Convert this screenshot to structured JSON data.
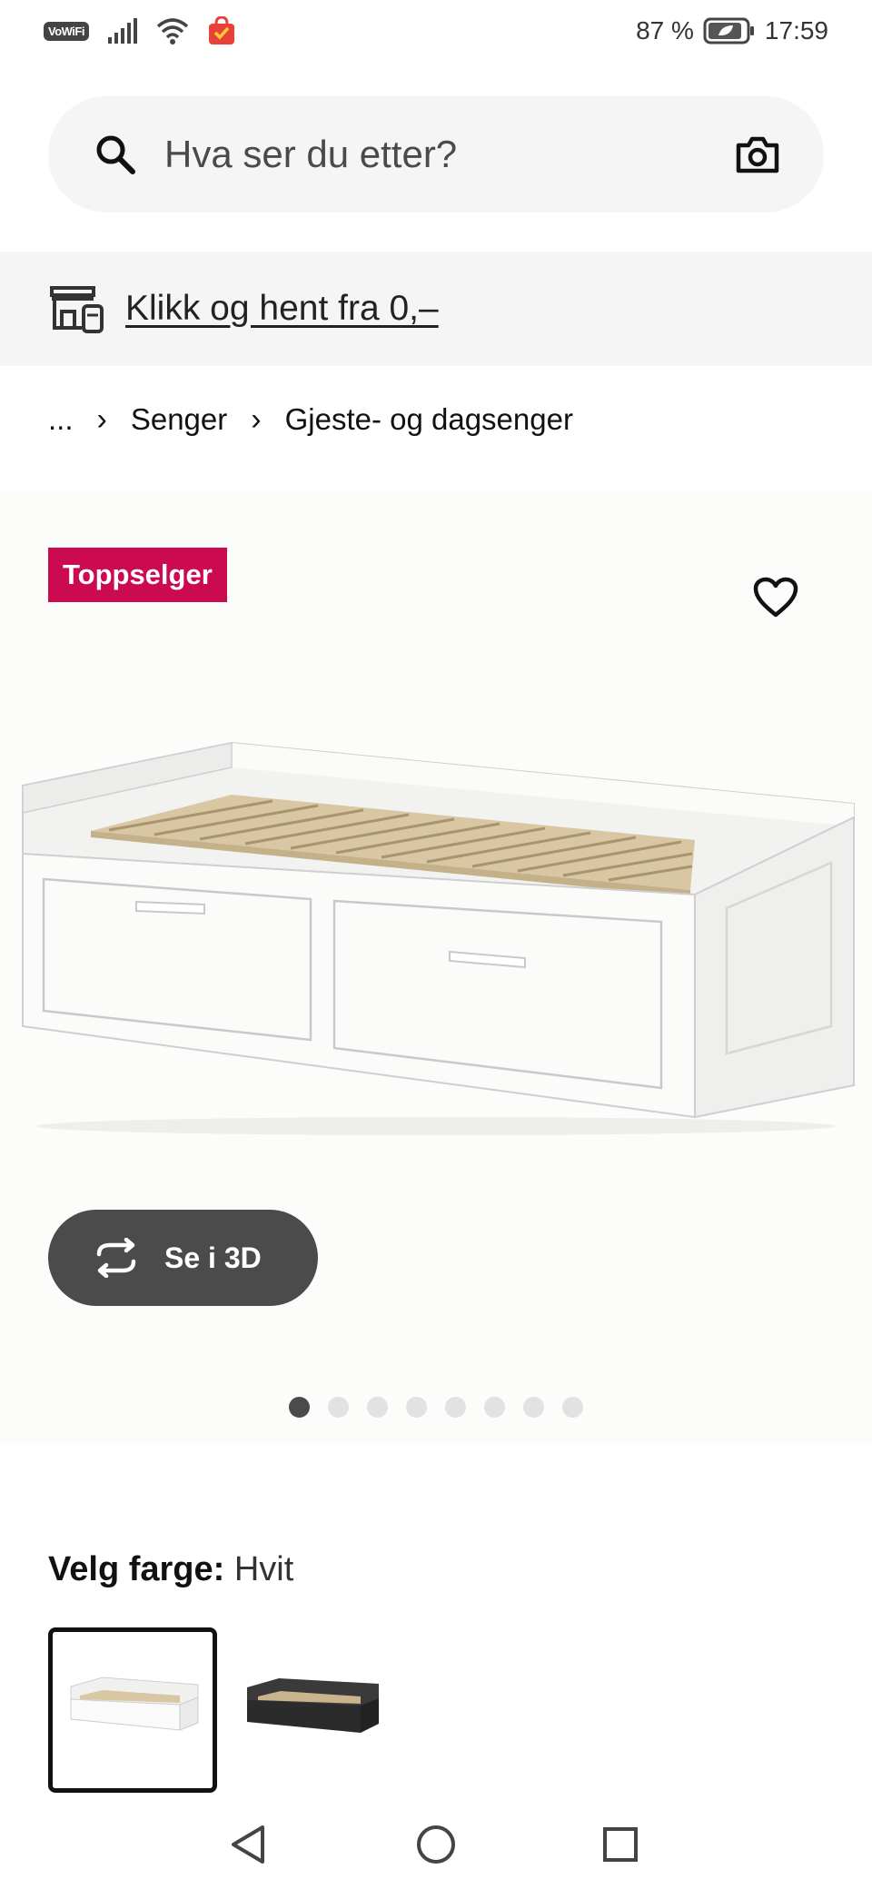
{
  "status_bar": {
    "vowifi": "VoWiFi",
    "battery": "87 %",
    "time": "17:59"
  },
  "search": {
    "placeholder": "Hva ser du etter?",
    "icon": "search-icon",
    "camera_icon": "camera-icon"
  },
  "click_collect": {
    "icon": "store-icon",
    "link_text": "Klikk og hent fra 0,–"
  },
  "breadcrumb": {
    "items": [
      "...",
      "Senger",
      "Gjeste- og dagsenger"
    ]
  },
  "product": {
    "badge": "Toppselger",
    "favorite_icon": "heart-icon",
    "view_3d_label": "Se i 3D",
    "image_count": 8,
    "active_image_index": 0
  },
  "color": {
    "label": "Velg farge:",
    "value": "Hvit",
    "options": [
      "white",
      "black"
    ],
    "selected_index": 0
  },
  "colors": {
    "badge": "#cc0a4f",
    "button_dark": "#4b4b4b",
    "surface": "#f5f5f5"
  },
  "nav_bar": {
    "icons": [
      "back-icon",
      "home-icon",
      "recents-icon"
    ]
  }
}
